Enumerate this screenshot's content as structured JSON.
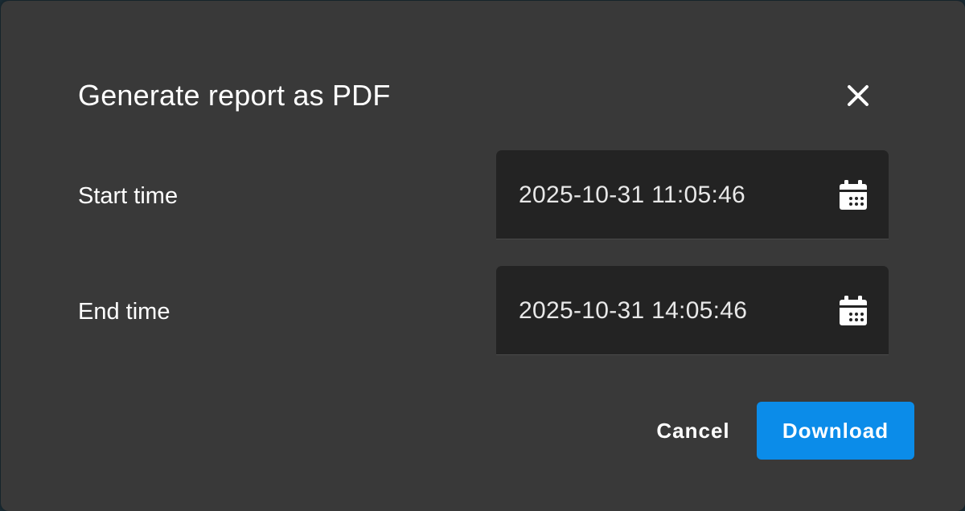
{
  "dialog": {
    "title": "Generate report as PDF",
    "close_icon": "close-icon"
  },
  "fields": {
    "start": {
      "label": "Start time",
      "value": "2025-10-31 11:05:46",
      "icon": "calendar-icon"
    },
    "end": {
      "label": "End time",
      "value": "2025-10-31 14:05:46",
      "icon": "calendar-icon"
    }
  },
  "actions": {
    "cancel_label": "Cancel",
    "download_label": "Download"
  },
  "colors": {
    "dialog_bg": "#393939",
    "field_bg": "#232323",
    "primary": "#0b8ce9",
    "text": "#ffffff"
  }
}
